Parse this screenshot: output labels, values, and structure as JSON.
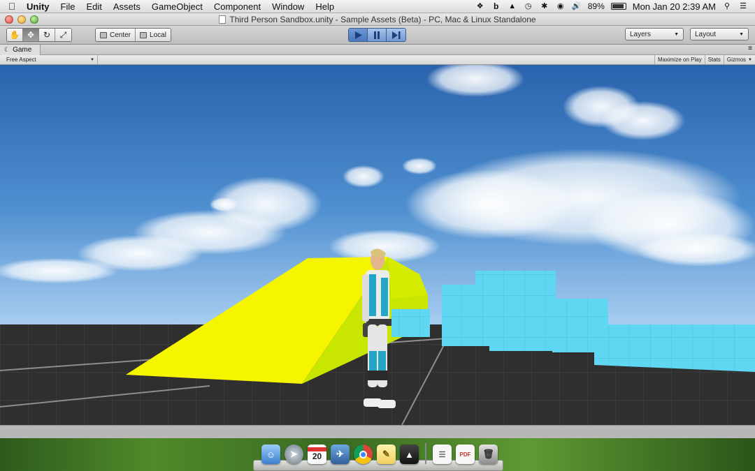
{
  "menubar": {
    "apple_icon": "apple-icon",
    "app_name": "Unity",
    "menus": [
      "File",
      "Edit",
      "Assets",
      "GameObject",
      "Component",
      "Window",
      "Help"
    ],
    "status": {
      "battery_percent": "89%",
      "clock": "Mon Jan 20  2:39 AM"
    }
  },
  "window": {
    "title": "Third Person Sandbox.unity - Sample Assets (Beta) - PC, Mac & Linux Standalone"
  },
  "toolbar": {
    "tools": [
      "hand-tool",
      "move-tool",
      "rotate-tool",
      "scale-tool"
    ],
    "active_tool": "move-tool",
    "pivot_label": "Center",
    "space_label": "Local",
    "play_state": "playing",
    "layers_label": "Layers",
    "layout_label": "Layout"
  },
  "game_view": {
    "tab_label": "Game",
    "aspect_label": "Free Aspect",
    "maximize_label": "Maximize on Play",
    "stats_label": "Stats",
    "gizmos_label": "Gizmos"
  },
  "scene_colors": {
    "sky_top": "#2f6fb8",
    "sky_bottom": "#9cc3ea",
    "ground": "#2f2f2f",
    "ramp": "#f5f500",
    "ramp_side": "#c8e000",
    "blocks": "#5fd8f4"
  },
  "dock": {
    "icons": [
      "finder-icon",
      "launchpad-icon",
      "calendar-icon",
      "preview-icon",
      "chrome-icon",
      "notes-icon",
      "unity-icon",
      "document-icon",
      "pdf-icon",
      "trash-icon"
    ],
    "calendar_day": "20"
  }
}
